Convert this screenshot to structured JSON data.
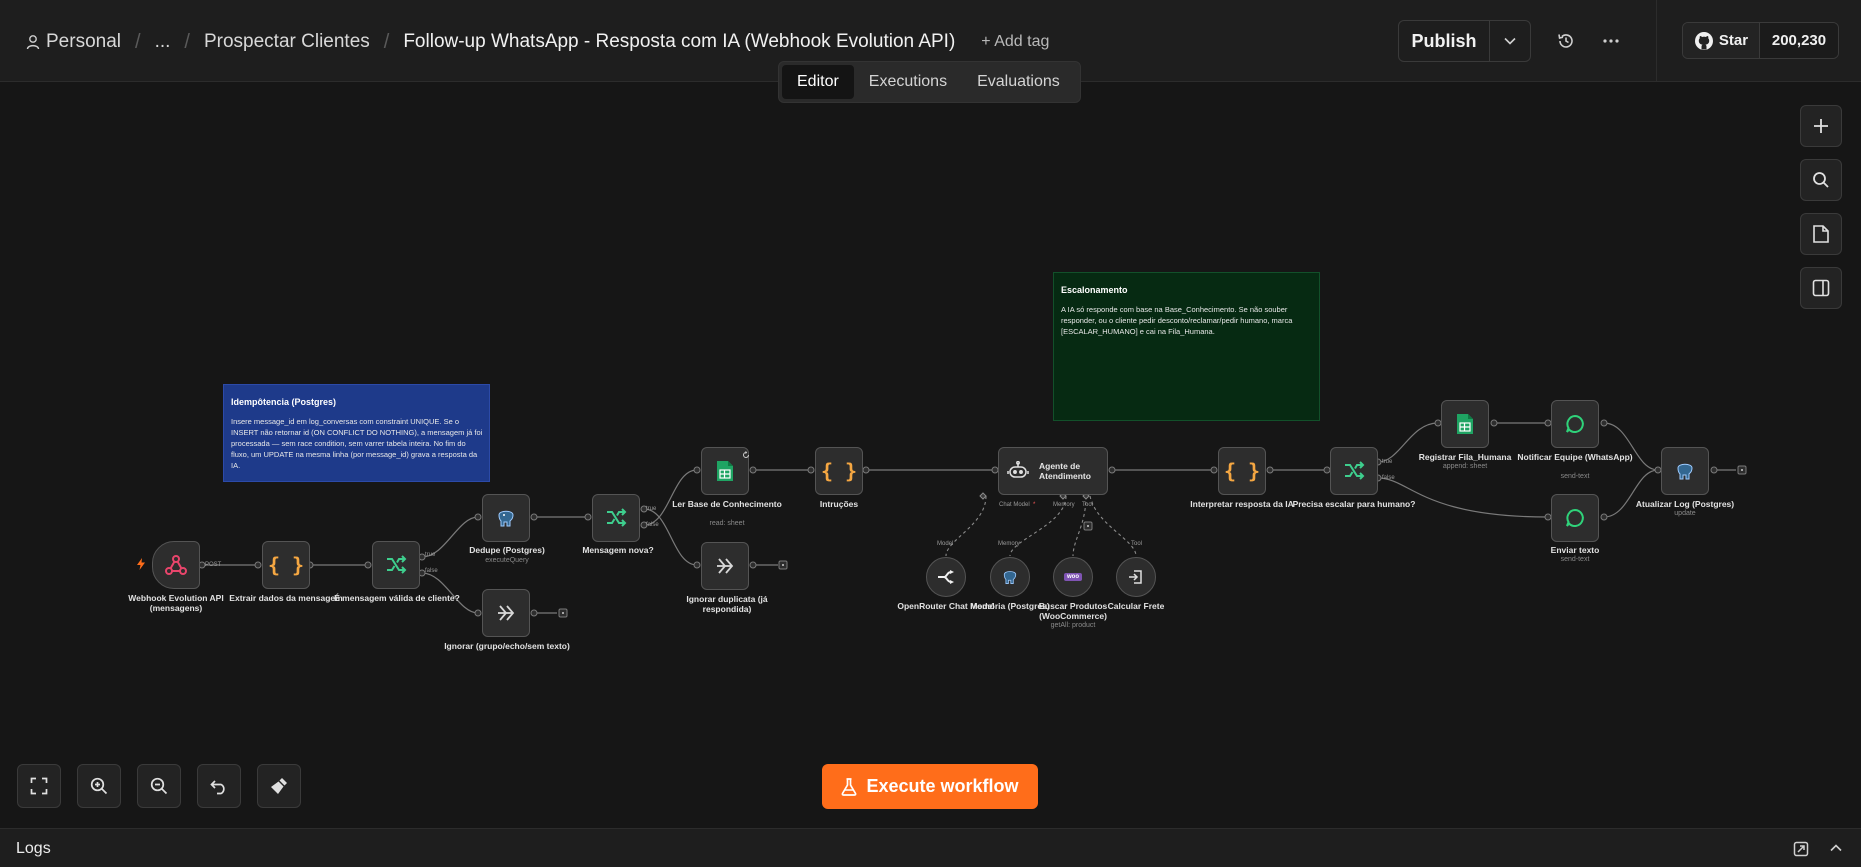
{
  "header": {
    "breadcrumb": {
      "project": "Personal",
      "ellipsis": "...",
      "folder": "Prospectar Clientes",
      "workflow_title": "Follow-up WhatsApp - Resposta com IA (Webhook Evolution API)",
      "add_tag": "+ Add tag"
    },
    "publish_label": "Publish",
    "github": {
      "star_label": "Star",
      "star_count": "200,230"
    }
  },
  "tabs": [
    {
      "label": "Editor",
      "active": true
    },
    {
      "label": "Executions",
      "active": false
    },
    {
      "label": "Evaluations",
      "active": false
    }
  ],
  "sticky_notes": {
    "idempotencia": {
      "title": "Idempôtencia (Postgres)",
      "body": "Insere message_id em log_conversas com constraint UNIQUE. Se o INSERT não retornar id (ON CONFLICT DO NOTHING), a mensagem já foi processada — sem race condition, sem varrer tabela inteira. No fim do fluxo, um UPDATE na mesma linha (por message_id) grava a resposta da IA."
    },
    "escalonamento": {
      "title": "Escalonamento",
      "body": "A IA só responde com base na Base_Conhecimento. Se não souber responder, ou o cliente pedir desconto/reclamar/pedir humano, marca [ESCALAR_HUMANO] e cai na Fila_Humana."
    }
  },
  "nodes": {
    "webhook": {
      "label": "Webhook Evolution API (mensagens)",
      "port": "POST"
    },
    "extrair": {
      "label": "Extrair dados da mensagem"
    },
    "valida": {
      "label": "É mensagem válida de cliente?",
      "true": "true",
      "false": "false"
    },
    "dedupe": {
      "label": "Dedupe (Postgres)",
      "sub": "executeQuery"
    },
    "ignorar_grupo": {
      "label": "Ignorar (grupo/echo/sem texto)"
    },
    "mensagem_nova": {
      "label": "Mensagem nova?",
      "true": "true",
      "false": "false"
    },
    "ler_base": {
      "label": "Ler Base de Conhecimento",
      "sub": "read: sheet"
    },
    "ignorar_dup": {
      "label": "Ignorar duplicata (já respondida)"
    },
    "instrucoes": {
      "label": "Intruções"
    },
    "agente": {
      "label": "Agente de Atendimento",
      "ports": {
        "chat_model": "Chat Model",
        "required": "*",
        "memory": "Memory",
        "tool": "Tool"
      }
    },
    "openrouter": {
      "label": "OpenRouter Chat Model",
      "port": "Model"
    },
    "memoria": {
      "label": "Memória (Postgres)",
      "port": "Memory"
    },
    "buscar": {
      "label": "Buscar Produtos (WooCommerce)",
      "sub": "getAll: product",
      "port": "Tool",
      "logo": "woo"
    },
    "calcular": {
      "label": "Calcular Frete",
      "port": "Tool"
    },
    "interpretar": {
      "label": "Interpretar resposta da IA"
    },
    "precisa": {
      "label": "Precisa escalar para humano?",
      "true": "true",
      "false": "false"
    },
    "registrar": {
      "label": "Registrar Fila_Humana",
      "sub": "append: sheet"
    },
    "notificar": {
      "label": "Notificar Equipe (WhatsApp)",
      "sub": "send-text"
    },
    "enviar": {
      "label": "Enviar texto",
      "sub": "send-text"
    },
    "atualizar": {
      "label": "Atualizar Log (Postgres)",
      "sub": "update"
    }
  },
  "execute_label": "Execute workflow",
  "logs_label": "Logs",
  "colors": {
    "accent": "#ff6d1a",
    "canvas_bg": "#161616",
    "sticky_blue": "#1e3a8a",
    "sticky_green": "#062a12",
    "code_brace": "#f5a742",
    "if_green": "#3ecf8e",
    "sheets_green": "#1fa463",
    "webhook_pink": "#e8456b"
  }
}
